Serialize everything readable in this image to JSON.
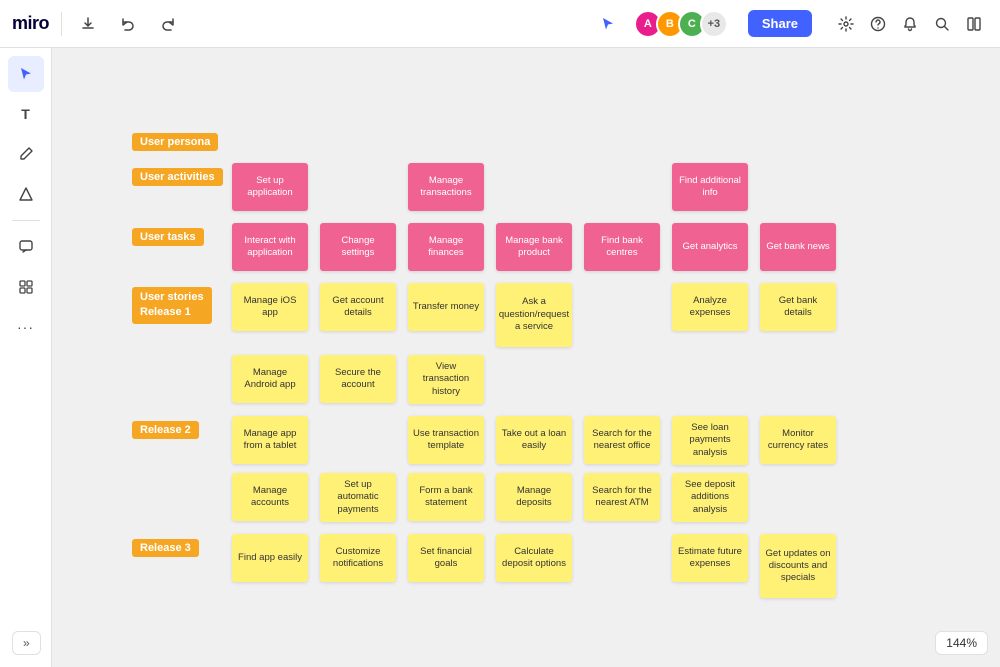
{
  "app": {
    "logo": "miro",
    "zoom": "144%"
  },
  "topbar": {
    "share_label": "Share",
    "avatar_count": "+3",
    "bottom_left_label": "»"
  },
  "tools": [
    {
      "id": "select",
      "icon": "▲",
      "active": true
    },
    {
      "id": "text",
      "icon": "T"
    },
    {
      "id": "pen",
      "icon": "✏"
    },
    {
      "id": "draw",
      "icon": "/"
    },
    {
      "id": "comment",
      "icon": "💬"
    },
    {
      "id": "grid",
      "icon": "⊞"
    },
    {
      "id": "more",
      "icon": "···"
    }
  ],
  "labels": {
    "user_persona": "User persona",
    "user_activities": "User activities",
    "user_tasks": "User tasks",
    "user_stories_r1": "User stories\nRelease 1",
    "release_2": "Release 2",
    "release_3": "Release 3"
  },
  "user_activities": [
    {
      "col": 0,
      "text": "Set up application",
      "type": "pink"
    },
    {
      "col": 2,
      "text": "Manage transactions",
      "type": "pink"
    },
    {
      "col": 5,
      "text": "Find additional info",
      "type": "pink"
    }
  ],
  "user_tasks": [
    {
      "col": 0,
      "text": "Interact with application",
      "type": "pink"
    },
    {
      "col": 1,
      "text": "Change settings",
      "type": "pink"
    },
    {
      "col": 2,
      "text": "Manage finances",
      "type": "pink"
    },
    {
      "col": 3,
      "text": "Manage bank product",
      "type": "pink"
    },
    {
      "col": 4,
      "text": "Find bank centres",
      "type": "pink"
    },
    {
      "col": 5,
      "text": "Get analytics",
      "type": "pink"
    },
    {
      "col": 6,
      "text": "Get bank news",
      "type": "pink"
    }
  ],
  "release_1_row1": [
    {
      "col": 0,
      "text": "Manage iOS app",
      "type": "yellow"
    },
    {
      "col": 1,
      "text": "Get account details",
      "type": "yellow"
    },
    {
      "col": 2,
      "text": "Transfer money",
      "type": "yellow"
    },
    {
      "col": 3,
      "text": "Ask a question/request a service",
      "type": "yellow"
    },
    {
      "col": 4,
      "text": "",
      "type": "empty"
    },
    {
      "col": 5,
      "text": "Analyze expenses",
      "type": "yellow"
    },
    {
      "col": 6,
      "text": "Get bank details",
      "type": "yellow"
    }
  ],
  "release_1_row2": [
    {
      "col": 0,
      "text": "Manage Android app",
      "type": "yellow"
    },
    {
      "col": 1,
      "text": "Secure the account",
      "type": "yellow"
    },
    {
      "col": 2,
      "text": "View transaction history",
      "type": "yellow"
    }
  ],
  "release_2_row1": [
    {
      "col": 0,
      "text": "Manage app from a tablet",
      "type": "yellow"
    },
    {
      "col": 1,
      "text": "",
      "type": "empty"
    },
    {
      "col": 2,
      "text": "Use transaction template",
      "type": "yellow"
    },
    {
      "col": 3,
      "text": "Take out a loan easily",
      "type": "yellow"
    },
    {
      "col": 4,
      "text": "Search for the nearest office",
      "type": "yellow"
    },
    {
      "col": 5,
      "text": "See loan payments analysis",
      "type": "yellow"
    },
    {
      "col": 6,
      "text": "Monitor currency rates",
      "type": "yellow"
    }
  ],
  "release_2_row2": [
    {
      "col": 0,
      "text": "Manage accounts",
      "type": "yellow"
    },
    {
      "col": 1,
      "text": "Set up automatic payments",
      "type": "yellow"
    },
    {
      "col": 2,
      "text": "Form a bank statement",
      "type": "yellow"
    },
    {
      "col": 3,
      "text": "Manage deposits",
      "type": "yellow"
    },
    {
      "col": 4,
      "text": "Search for the nearest ATM",
      "type": "yellow"
    },
    {
      "col": 5,
      "text": "See deposit additions analysis",
      "type": "yellow"
    }
  ],
  "release_3_row1": [
    {
      "col": 0,
      "text": "Find app easily",
      "type": "yellow"
    },
    {
      "col": 1,
      "text": "Customize notifications",
      "type": "yellow"
    },
    {
      "col": 2,
      "text": "Set financial goals",
      "type": "yellow"
    },
    {
      "col": 3,
      "text": "Calculate deposit options",
      "type": "yellow"
    },
    {
      "col": 4,
      "text": "",
      "type": "empty"
    },
    {
      "col": 5,
      "text": "Estimate future expenses",
      "type": "yellow"
    },
    {
      "col": 6,
      "text": "Get updates on discounts and specials",
      "type": "yellow"
    }
  ]
}
